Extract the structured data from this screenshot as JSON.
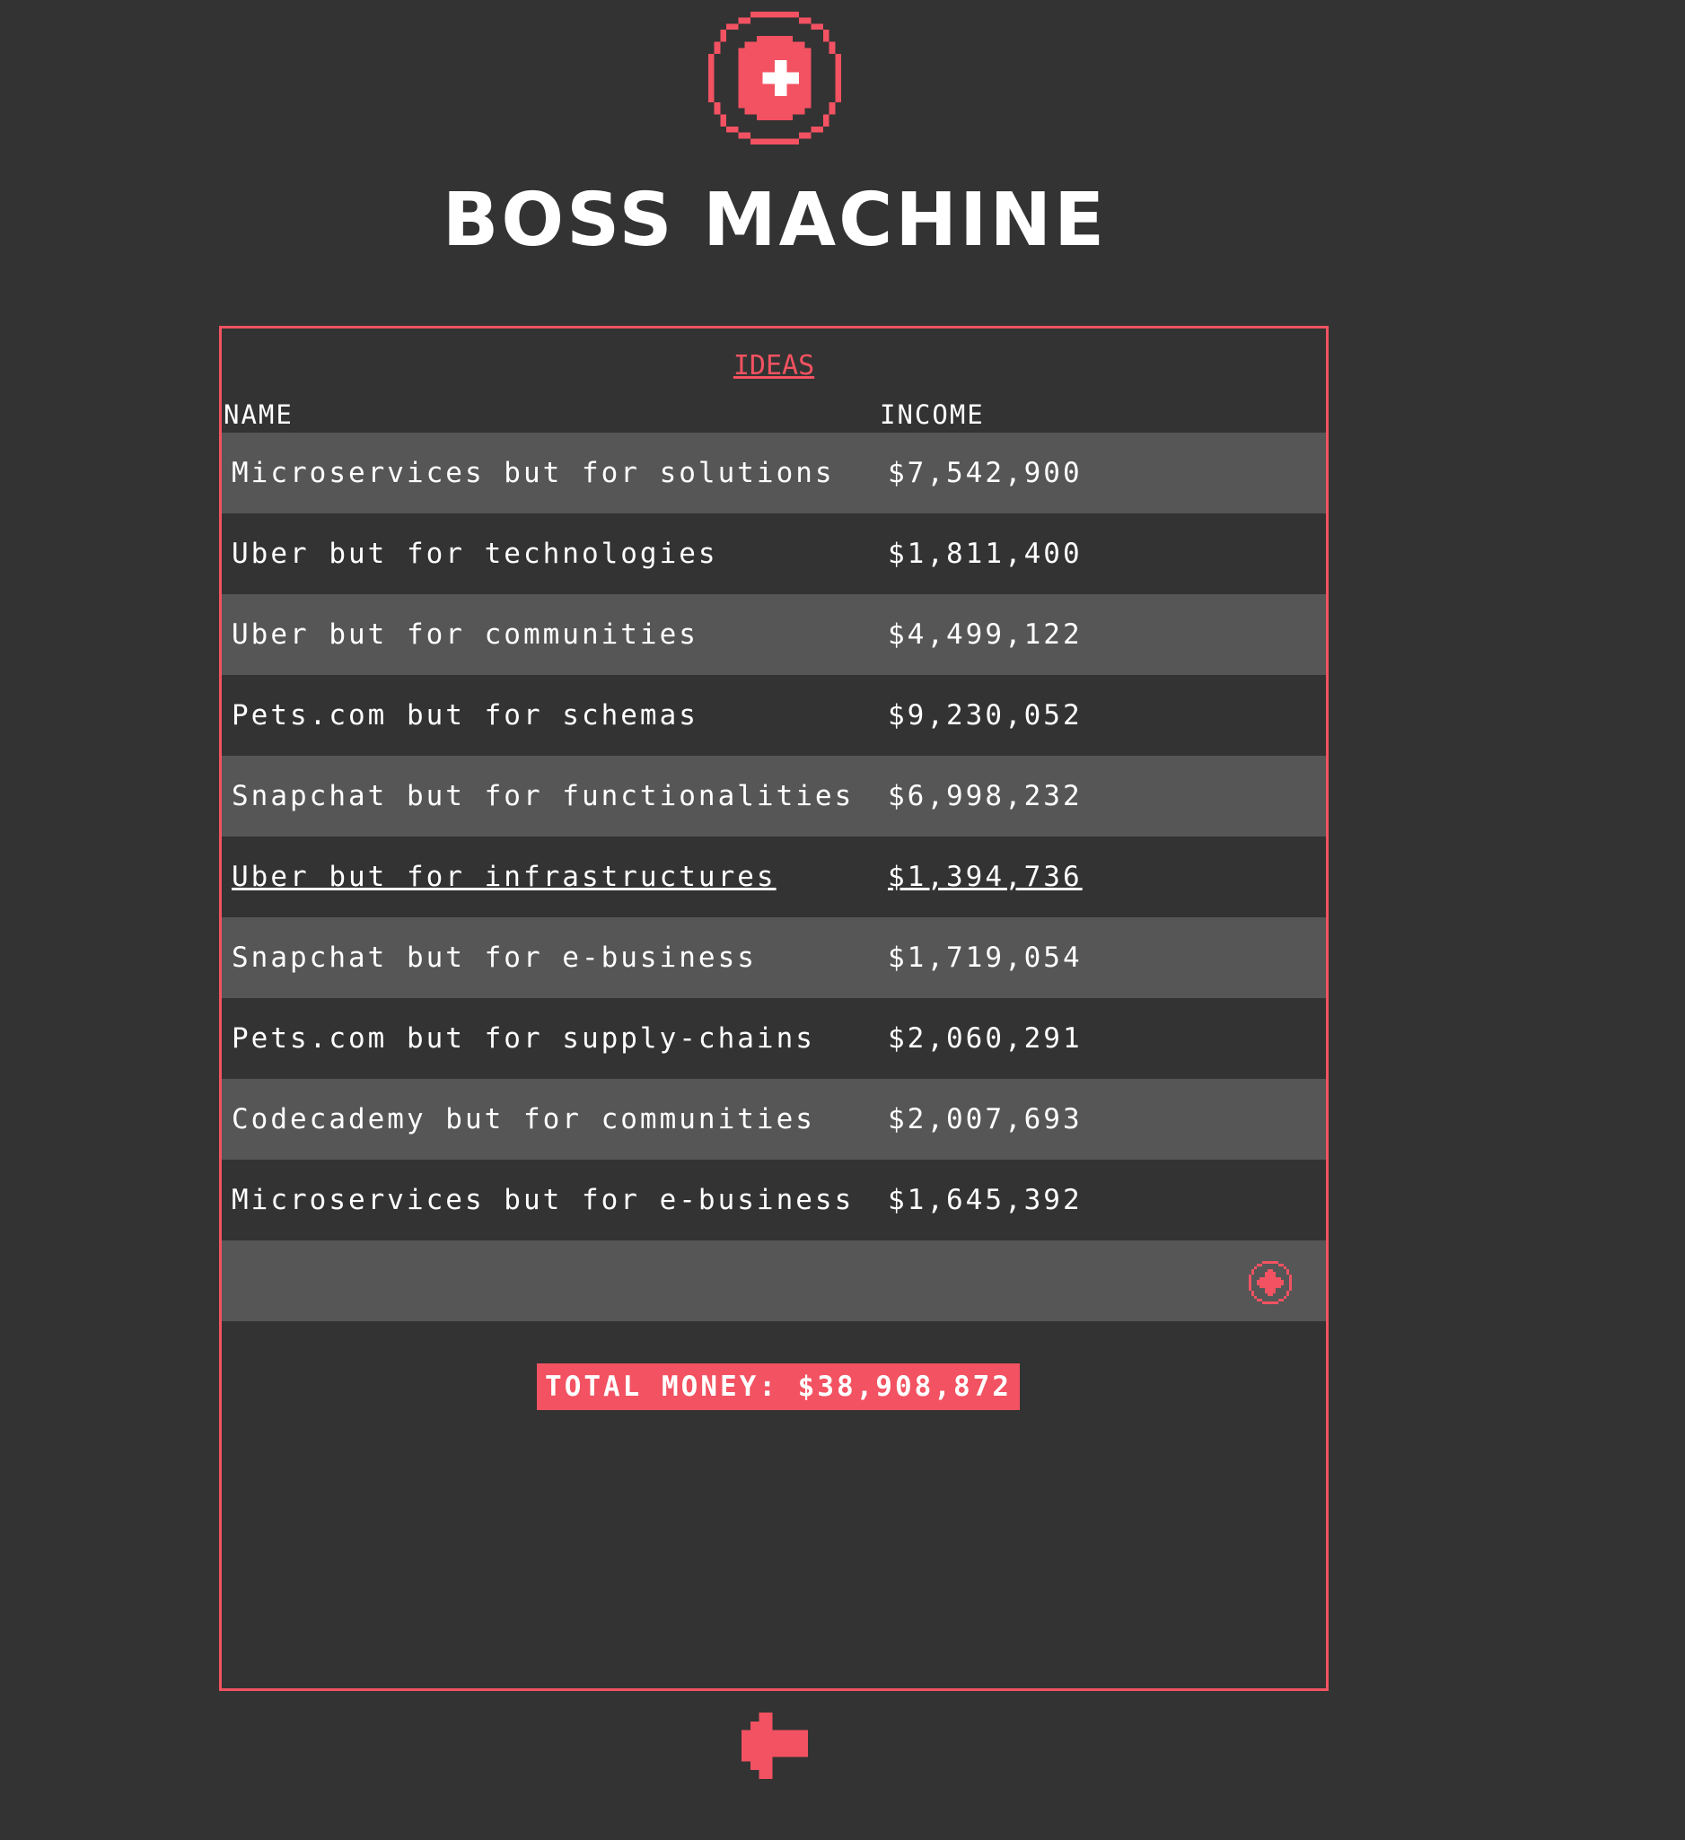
{
  "app": {
    "title": "BOSS MACHINE",
    "logo_icon": "boss-machine-logo-icon"
  },
  "ideas": {
    "section_title": "IDEAS",
    "columns": {
      "name": "NAME",
      "income": "INCOME"
    },
    "rows": [
      {
        "name": "Microservices but for solutions",
        "income": "$7,542,900"
      },
      {
        "name": "Uber but for technologies",
        "income": "$1,811,400"
      },
      {
        "name": "Uber but for communities",
        "income": "$4,499,122"
      },
      {
        "name": "Pets.com but for schemas",
        "income": "$9,230,052"
      },
      {
        "name": "Snapchat but for functionalities",
        "income": "$6,998,232"
      },
      {
        "name": "Uber but for infrastructures",
        "income": "$1,394,736"
      },
      {
        "name": "Snapchat but for e-business",
        "income": "$1,719,054"
      },
      {
        "name": "Pets.com but for supply-chains",
        "income": "$2,060,291"
      },
      {
        "name": "Codecademy but for communities",
        "income": "$2,007,693"
      },
      {
        "name": "Microservices but for e-business",
        "income": "$1,645,392"
      }
    ],
    "hovered_row_index": 5,
    "add_icon": "plus-circle-icon",
    "total_label": "TOTAL MONEY: $38,908,872"
  },
  "navigation": {
    "back_icon": "back-arrow-icon"
  },
  "colors": {
    "accent": "#f25261",
    "background": "#333333",
    "row_alt": "#565656",
    "text": "#ffffff"
  }
}
